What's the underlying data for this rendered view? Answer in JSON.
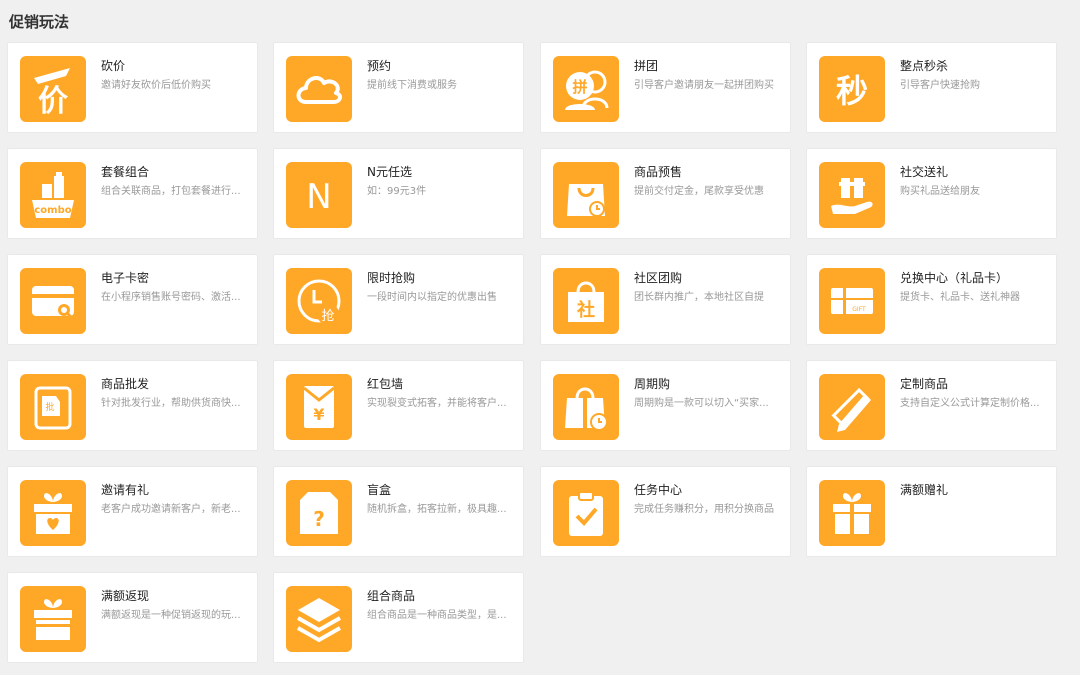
{
  "page": {
    "title": "促销玩法"
  },
  "colors": {
    "icon_bg": "#ffa726",
    "card_bg": "#ffffff",
    "page_bg": "#f0f0f0"
  },
  "cards": [
    {
      "name": "砍价",
      "desc": "邀请好友砍价后低价购买",
      "icon": "bargain-icon"
    },
    {
      "name": "预约",
      "desc": "提前线下消费或服务",
      "icon": "cloud-icon"
    },
    {
      "name": "拼团",
      "desc": "引导客户邀请朋友一起拼团购买",
      "icon": "group-buy-icon"
    },
    {
      "name": "整点秒杀",
      "desc": "引导客户快速抢购",
      "icon": "flash-sale-icon"
    },
    {
      "name": "套餐组合",
      "desc": "组合关联商品，打包套餐进行...",
      "icon": "combo-icon"
    },
    {
      "name": "N元任选",
      "desc": "如：99元3件",
      "icon": "n-letter-icon"
    },
    {
      "name": "商品预售",
      "desc": "提前交付定金，尾款享受优惠",
      "icon": "presale-bag-icon"
    },
    {
      "name": "社交送礼",
      "desc": "购买礼品送给朋友",
      "icon": "gift-hand-icon"
    },
    {
      "name": "电子卡密",
      "desc": "在小程序销售账号密码、激活...",
      "icon": "card-key-icon"
    },
    {
      "name": "限时抢购",
      "desc": "一段时间内以指定的优惠出售",
      "icon": "clock-grab-icon"
    },
    {
      "name": "社区团购",
      "desc": "团长群内推广，本地社区自提",
      "icon": "community-bag-icon"
    },
    {
      "name": "兑换中心（礼品卡）",
      "desc": "提货卡、礼品卡、送礼神器",
      "icon": "gift-card-icon"
    },
    {
      "name": "商品批发",
      "desc": "针对批发行业，帮助供货商快...",
      "icon": "wholesale-icon"
    },
    {
      "name": "红包墙",
      "desc": "实现裂变式拓客，并能将客户...",
      "icon": "red-envelope-icon"
    },
    {
      "name": "周期购",
      "desc": "周期购是一款可以切入“买家...",
      "icon": "periodic-bag-icon"
    },
    {
      "name": "定制商品",
      "desc": "支持自定义公式计算定制价格...",
      "icon": "ruler-pencil-icon"
    },
    {
      "name": "邀请有礼",
      "desc": "老客户成功邀请新客户，新老...",
      "icon": "invite-gift-icon"
    },
    {
      "name": "盲盒",
      "desc": "随机拆盒，拓客拉新，极具趣...",
      "icon": "blind-box-icon"
    },
    {
      "name": "任务中心",
      "desc": "完成任务赚积分，用积分换商品",
      "icon": "task-clipboard-icon"
    },
    {
      "name": "满额赠礼",
      "desc": "",
      "icon": "gift-box-icon"
    },
    {
      "name": "满额返现",
      "desc": "满额返现是一种促销返现的玩...",
      "icon": "cashback-gift-icon"
    },
    {
      "name": "组合商品",
      "desc": "组合商品是一种商品类型，是...",
      "icon": "layers-icon"
    }
  ]
}
